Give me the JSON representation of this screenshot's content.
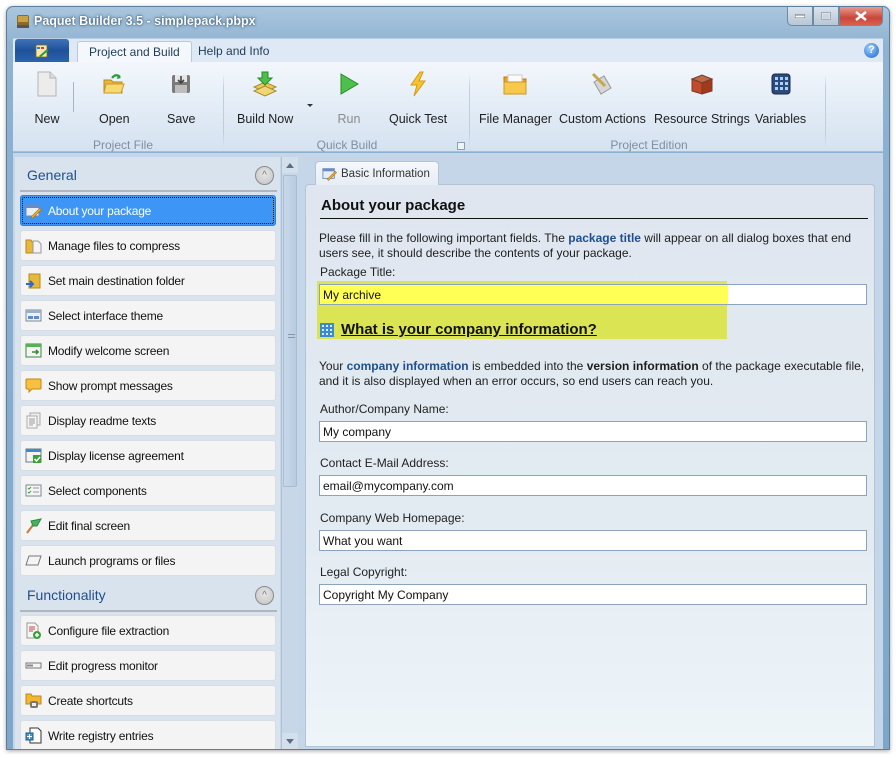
{
  "window": {
    "title": "Paquet Builder 3.5 - simplepack.pbpx",
    "buttons": [
      "minimize",
      "maximize",
      "close"
    ]
  },
  "ribbon_tabs": [
    {
      "label": "Project and Build",
      "active": true
    },
    {
      "label": "Help and Info",
      "active": false
    }
  ],
  "ribbon": {
    "groups": [
      {
        "label": "Project File",
        "buttons": [
          {
            "label": "New",
            "icon": "new-document-icon"
          },
          {
            "label": "Open",
            "icon": "open-folder-icon"
          },
          {
            "label": "Save",
            "icon": "save-disk-icon"
          }
        ]
      },
      {
        "label": "Quick Build",
        "buttons": [
          {
            "label": "Build Now",
            "icon": "build-icon",
            "has_dropdown": true
          },
          {
            "label": "Run",
            "icon": "run-play-icon",
            "disabled": true
          },
          {
            "label": "Quick Test",
            "icon": "lightning-icon"
          }
        ]
      },
      {
        "label": "Project Edition",
        "buttons": [
          {
            "label": "File Manager",
            "icon": "file-manager-folder-icon"
          },
          {
            "label": "Custom Actions",
            "icon": "custom-actions-icon"
          },
          {
            "label": "Resource Strings",
            "icon": "resource-strings-icon"
          },
          {
            "label": "Variables",
            "icon": "variables-icon"
          }
        ]
      }
    ]
  },
  "sidebar": {
    "sections": [
      {
        "title": "General",
        "items": [
          {
            "label": "About your package",
            "icon": "edit-form-icon",
            "selected": true
          },
          {
            "label": "Manage files to compress",
            "icon": "files-folder-icon"
          },
          {
            "label": "Set main destination folder",
            "icon": "destination-folder-icon"
          },
          {
            "label": "Select interface theme",
            "icon": "theme-window-icon"
          },
          {
            "label": "Modify welcome screen",
            "icon": "welcome-screen-icon"
          },
          {
            "label": "Show prompt messages",
            "icon": "speech-bubble-icon"
          },
          {
            "label": "Display readme texts",
            "icon": "readme-document-icon"
          },
          {
            "label": "Display license agreement",
            "icon": "license-check-icon"
          },
          {
            "label": "Select components",
            "icon": "checklist-icon"
          },
          {
            "label": "Edit final screen",
            "icon": "finish-flag-icon"
          },
          {
            "label": "Launch programs or files",
            "icon": "launch-parallelogram-icon"
          }
        ]
      },
      {
        "title": "Functionality",
        "items": [
          {
            "label": "Configure file extraction",
            "icon": "extraction-document-icon"
          },
          {
            "label": "Edit progress monitor",
            "icon": "progress-bar-icon"
          },
          {
            "label": "Create shortcuts",
            "icon": "shortcut-folder-icon"
          },
          {
            "label": "Write registry entries",
            "icon": "registry-icon"
          }
        ]
      }
    ]
  },
  "content": {
    "tab_label": "Basic Information",
    "section1": {
      "heading": "About your package",
      "para_parts": [
        "Please fill in the following important fields. The ",
        "package title",
        " will appear on all dialog boxes that end users see, it should describe the contents of your package."
      ],
      "field": {
        "label": "Package Title:",
        "value": "My archive"
      }
    },
    "section2": {
      "heading": "What is your company information?",
      "para_parts": [
        "Your ",
        "company information",
        " is embedded into the ",
        "version information",
        " of the package executable file, and it is also displayed when an error occurs, so end users can reach you."
      ],
      "fields": [
        {
          "label": "Author/Company Name:",
          "value": "My company"
        },
        {
          "label": "Contact E-Mail Address:",
          "value": "email@mycompany.com"
        },
        {
          "label": "Company Web Homepage:",
          "value": "What you want"
        },
        {
          "label": "Legal Copyright:",
          "value": "Copyright My Company"
        }
      ]
    }
  },
  "colors": {
    "selected_item": "#3d95f5",
    "section_title": "#1f4f8f",
    "highlight": "#dae43c",
    "titlebar": "#8fb2d1"
  }
}
